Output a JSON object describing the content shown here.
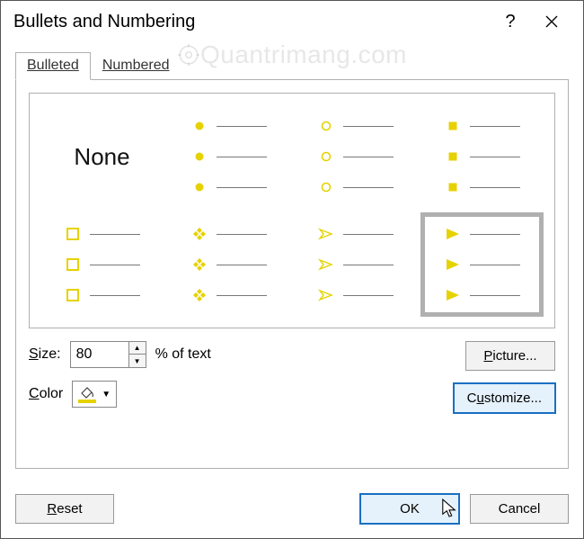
{
  "title": "Bullets and Numbering",
  "help_icon": "?",
  "tabs": {
    "bulleted": "Bulleted",
    "numbered": "Numbered",
    "active": "bulleted"
  },
  "styles": {
    "none": "None",
    "selected_index": 7,
    "items": [
      {
        "id": "none",
        "kind": "none"
      },
      {
        "id": "disc",
        "kind": "filled-circle"
      },
      {
        "id": "ring",
        "kind": "hollow-circle"
      },
      {
        "id": "square",
        "kind": "filled-square"
      },
      {
        "id": "hollow-square",
        "kind": "hollow-square"
      },
      {
        "id": "four-diamonds",
        "kind": "four-diamonds"
      },
      {
        "id": "arrowhead",
        "kind": "arrowhead-outline"
      },
      {
        "id": "play",
        "kind": "play-triangle"
      }
    ]
  },
  "size": {
    "label": "Size:",
    "value": "80",
    "suffix": "% of text"
  },
  "color": {
    "label": "Color",
    "value": "#e6d200"
  },
  "buttons": {
    "picture": "Picture...",
    "customize": "Customize...",
    "reset": "Reset",
    "ok": "OK",
    "cancel": "Cancel"
  },
  "watermark": "Quantrimang.com"
}
